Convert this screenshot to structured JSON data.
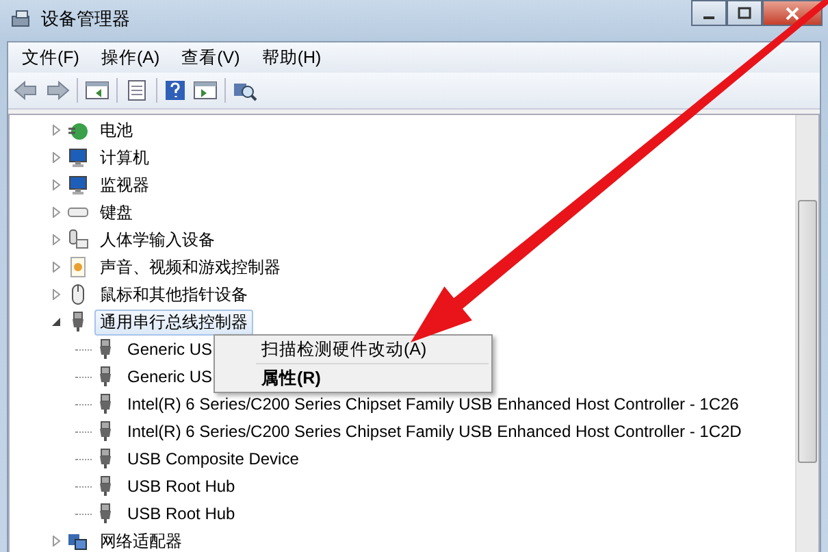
{
  "window": {
    "title": "设备管理器"
  },
  "menu_bar": [
    "文件(F)",
    "操作(A)",
    "查看(V)",
    "帮助(H)"
  ],
  "tree": [
    {
      "label": "电池",
      "expanded": false
    },
    {
      "label": "计算机",
      "expanded": false
    },
    {
      "label": "监视器",
      "expanded": false
    },
    {
      "label": "键盘",
      "expanded": false
    },
    {
      "label": "人体学输入设备",
      "expanded": false
    },
    {
      "label": "声音、视频和游戏控制器",
      "expanded": false
    },
    {
      "label": "鼠标和其他指针设备",
      "expanded": false
    },
    {
      "label": "通用串行总线控制器",
      "expanded": true,
      "selected": true,
      "children": [
        {
          "label": "Generic US"
        },
        {
          "label": "Generic US"
        },
        {
          "label": "Intel(R) 6 Series/C200 Series Chipset Family USB Enhanced Host Controller - 1C26"
        },
        {
          "label": "Intel(R) 6 Series/C200 Series Chipset Family USB Enhanced Host Controller - 1C2D"
        },
        {
          "label": "USB Composite Device"
        },
        {
          "label": "USB Root Hub"
        },
        {
          "label": "USB Root Hub"
        }
      ]
    },
    {
      "label": "网络适配器",
      "expanded": false
    }
  ],
  "context_menu": [
    {
      "label": "扫描检测硬件改动(A)",
      "default": false
    },
    {
      "label": "属性(R)",
      "default": true
    }
  ]
}
